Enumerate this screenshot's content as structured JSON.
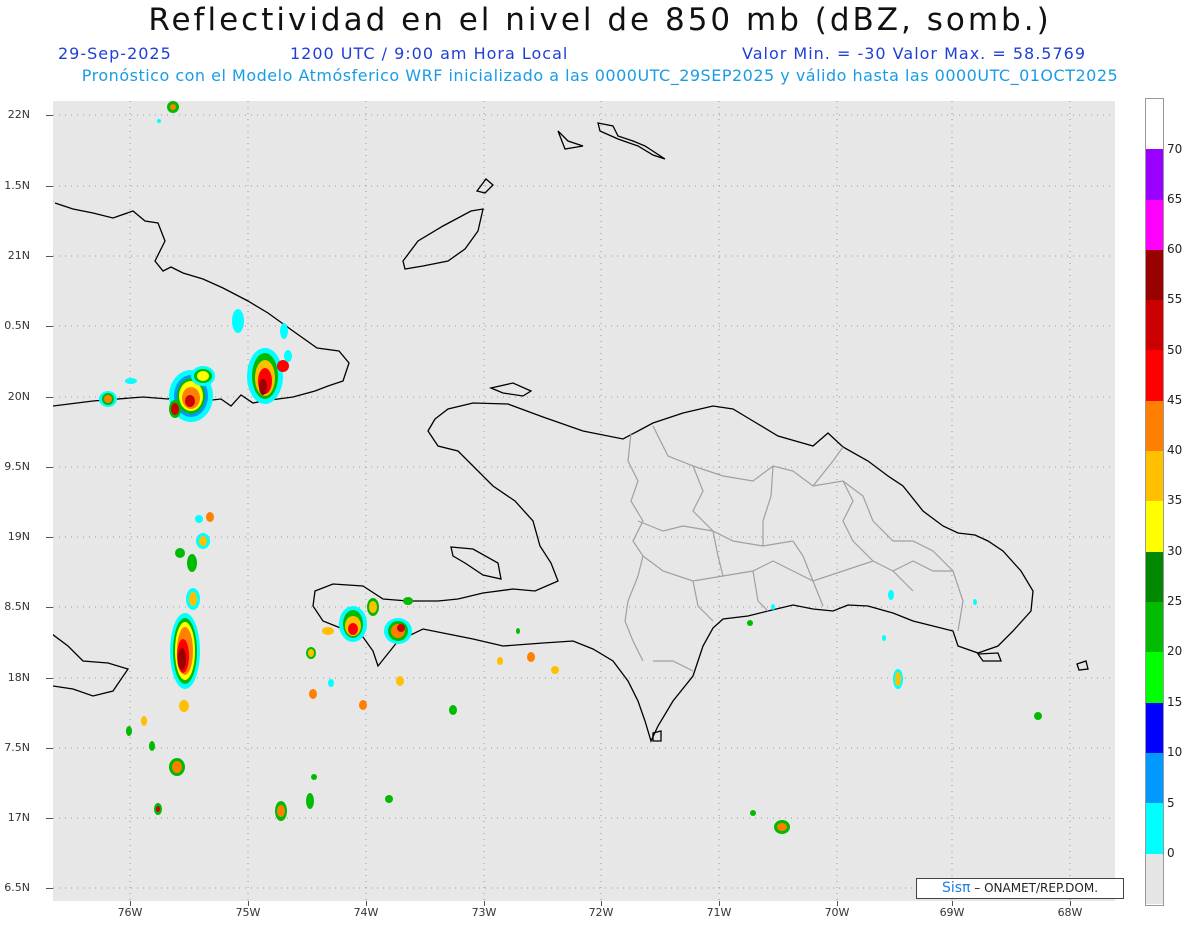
{
  "header": {
    "title": "Reflectividad en el nivel de 850 mb (dBZ, somb.)",
    "date": "29-Sep-2025",
    "time": "1200 UTC / 9:00 am Hora Local",
    "range": "Valor Min. = -30  Valor Max. = 58.5769",
    "subtitle": "Pronóstico con el Modelo Atmósferico WRF inicializado a las 0000UTC_29SEP2025 y válido hasta las  0000UTC_01OCT2025"
  },
  "axes": {
    "lat_labels": [
      "22N",
      "1.5N",
      "21N",
      "0.5N",
      "20N",
      "9.5N",
      "19N",
      "8.5N",
      "18N",
      "7.5N",
      "17N",
      "6.5N"
    ],
    "lon_labels": [
      "76W",
      "75W",
      "74W",
      "73W",
      "72W",
      "71W",
      "70W",
      "69W",
      "68W"
    ]
  },
  "colorbar": {
    "labels": [
      "70",
      "65",
      "60",
      "55",
      "50",
      "45",
      "40",
      "35",
      "30",
      "25",
      "20",
      "15",
      "10",
      "5",
      "0"
    ],
    "colors": [
      "#9900ff",
      "#ff00ff",
      "#990000",
      "#cc0000",
      "#ff0000",
      "#ff7f00",
      "#ffc000",
      "#ffff00",
      "#008800",
      "#00bb00",
      "#00ff00",
      "#0000ff",
      "#0099ff",
      "#00ffff",
      "#e5e5e5"
    ]
  },
  "credit": {
    "logo": "Sisπ",
    "text": "– ONAMET/REP.DOM."
  }
}
